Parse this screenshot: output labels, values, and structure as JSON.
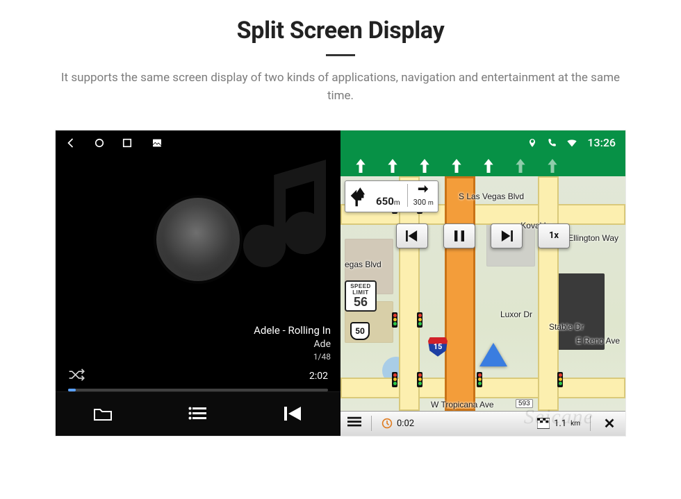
{
  "header": {
    "title": "Split Screen Display",
    "subtitle": "It supports the same screen display of two kinds of applications, navigation and entertainment at the same time."
  },
  "statusbar": {
    "time": "13:26"
  },
  "music": {
    "track_title": "Adele - Rolling In",
    "artist": "Ade",
    "track_index": "1/48",
    "elapsed": "2:02"
  },
  "nav": {
    "turn_primary_distance": "650",
    "turn_primary_unit": "m",
    "turn_next_distance": "300",
    "turn_next_unit": "m",
    "speed_limit_label_1": "SPEED",
    "speed_limit_label_2": "LIMIT",
    "speed_limit_value": "56",
    "highway_us": "50",
    "highway_interstate": "15",
    "playback_speed": "1x",
    "streets": {
      "top": "S Las Vegas Blvd",
      "right1": "Koval Ln",
      "right2": "Duke Ellington Way",
      "mid_left": "egas Blvd",
      "luxor": "Luxor Dr",
      "stable": "Stable Dr",
      "reno": "E Reno Ave",
      "bottom": "W Tropicana Ave",
      "bottom_badge": "593"
    },
    "bottom": {
      "eta_time": "0:02",
      "eta_remaining": "1.1",
      "eta_unit": "km"
    }
  },
  "watermark": "Seicane"
}
